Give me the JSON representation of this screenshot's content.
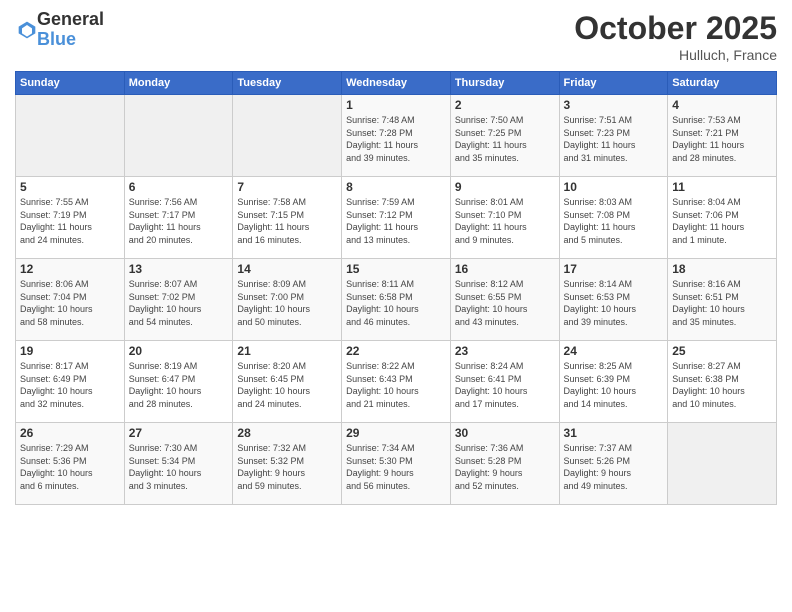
{
  "logo": {
    "general": "General",
    "blue": "Blue"
  },
  "title": "October 2025",
  "location": "Hulluch, France",
  "days_of_week": [
    "Sunday",
    "Monday",
    "Tuesday",
    "Wednesday",
    "Thursday",
    "Friday",
    "Saturday"
  ],
  "weeks": [
    [
      {
        "day": "",
        "info": ""
      },
      {
        "day": "",
        "info": ""
      },
      {
        "day": "",
        "info": ""
      },
      {
        "day": "1",
        "info": "Sunrise: 7:48 AM\nSunset: 7:28 PM\nDaylight: 11 hours\nand 39 minutes."
      },
      {
        "day": "2",
        "info": "Sunrise: 7:50 AM\nSunset: 7:25 PM\nDaylight: 11 hours\nand 35 minutes."
      },
      {
        "day": "3",
        "info": "Sunrise: 7:51 AM\nSunset: 7:23 PM\nDaylight: 11 hours\nand 31 minutes."
      },
      {
        "day": "4",
        "info": "Sunrise: 7:53 AM\nSunset: 7:21 PM\nDaylight: 11 hours\nand 28 minutes."
      }
    ],
    [
      {
        "day": "5",
        "info": "Sunrise: 7:55 AM\nSunset: 7:19 PM\nDaylight: 11 hours\nand 24 minutes."
      },
      {
        "day": "6",
        "info": "Sunrise: 7:56 AM\nSunset: 7:17 PM\nDaylight: 11 hours\nand 20 minutes."
      },
      {
        "day": "7",
        "info": "Sunrise: 7:58 AM\nSunset: 7:15 PM\nDaylight: 11 hours\nand 16 minutes."
      },
      {
        "day": "8",
        "info": "Sunrise: 7:59 AM\nSunset: 7:12 PM\nDaylight: 11 hours\nand 13 minutes."
      },
      {
        "day": "9",
        "info": "Sunrise: 8:01 AM\nSunset: 7:10 PM\nDaylight: 11 hours\nand 9 minutes."
      },
      {
        "day": "10",
        "info": "Sunrise: 8:03 AM\nSunset: 7:08 PM\nDaylight: 11 hours\nand 5 minutes."
      },
      {
        "day": "11",
        "info": "Sunrise: 8:04 AM\nSunset: 7:06 PM\nDaylight: 11 hours\nand 1 minute."
      }
    ],
    [
      {
        "day": "12",
        "info": "Sunrise: 8:06 AM\nSunset: 7:04 PM\nDaylight: 10 hours\nand 58 minutes."
      },
      {
        "day": "13",
        "info": "Sunrise: 8:07 AM\nSunset: 7:02 PM\nDaylight: 10 hours\nand 54 minutes."
      },
      {
        "day": "14",
        "info": "Sunrise: 8:09 AM\nSunset: 7:00 PM\nDaylight: 10 hours\nand 50 minutes."
      },
      {
        "day": "15",
        "info": "Sunrise: 8:11 AM\nSunset: 6:58 PM\nDaylight: 10 hours\nand 46 minutes."
      },
      {
        "day": "16",
        "info": "Sunrise: 8:12 AM\nSunset: 6:55 PM\nDaylight: 10 hours\nand 43 minutes."
      },
      {
        "day": "17",
        "info": "Sunrise: 8:14 AM\nSunset: 6:53 PM\nDaylight: 10 hours\nand 39 minutes."
      },
      {
        "day": "18",
        "info": "Sunrise: 8:16 AM\nSunset: 6:51 PM\nDaylight: 10 hours\nand 35 minutes."
      }
    ],
    [
      {
        "day": "19",
        "info": "Sunrise: 8:17 AM\nSunset: 6:49 PM\nDaylight: 10 hours\nand 32 minutes."
      },
      {
        "day": "20",
        "info": "Sunrise: 8:19 AM\nSunset: 6:47 PM\nDaylight: 10 hours\nand 28 minutes."
      },
      {
        "day": "21",
        "info": "Sunrise: 8:20 AM\nSunset: 6:45 PM\nDaylight: 10 hours\nand 24 minutes."
      },
      {
        "day": "22",
        "info": "Sunrise: 8:22 AM\nSunset: 6:43 PM\nDaylight: 10 hours\nand 21 minutes."
      },
      {
        "day": "23",
        "info": "Sunrise: 8:24 AM\nSunset: 6:41 PM\nDaylight: 10 hours\nand 17 minutes."
      },
      {
        "day": "24",
        "info": "Sunrise: 8:25 AM\nSunset: 6:39 PM\nDaylight: 10 hours\nand 14 minutes."
      },
      {
        "day": "25",
        "info": "Sunrise: 8:27 AM\nSunset: 6:38 PM\nDaylight: 10 hours\nand 10 minutes."
      }
    ],
    [
      {
        "day": "26",
        "info": "Sunrise: 7:29 AM\nSunset: 5:36 PM\nDaylight: 10 hours\nand 6 minutes."
      },
      {
        "day": "27",
        "info": "Sunrise: 7:30 AM\nSunset: 5:34 PM\nDaylight: 10 hours\nand 3 minutes."
      },
      {
        "day": "28",
        "info": "Sunrise: 7:32 AM\nSunset: 5:32 PM\nDaylight: 9 hours\nand 59 minutes."
      },
      {
        "day": "29",
        "info": "Sunrise: 7:34 AM\nSunset: 5:30 PM\nDaylight: 9 hours\nand 56 minutes."
      },
      {
        "day": "30",
        "info": "Sunrise: 7:36 AM\nSunset: 5:28 PM\nDaylight: 9 hours\nand 52 minutes."
      },
      {
        "day": "31",
        "info": "Sunrise: 7:37 AM\nSunset: 5:26 PM\nDaylight: 9 hours\nand 49 minutes."
      },
      {
        "day": "",
        "info": ""
      }
    ]
  ]
}
